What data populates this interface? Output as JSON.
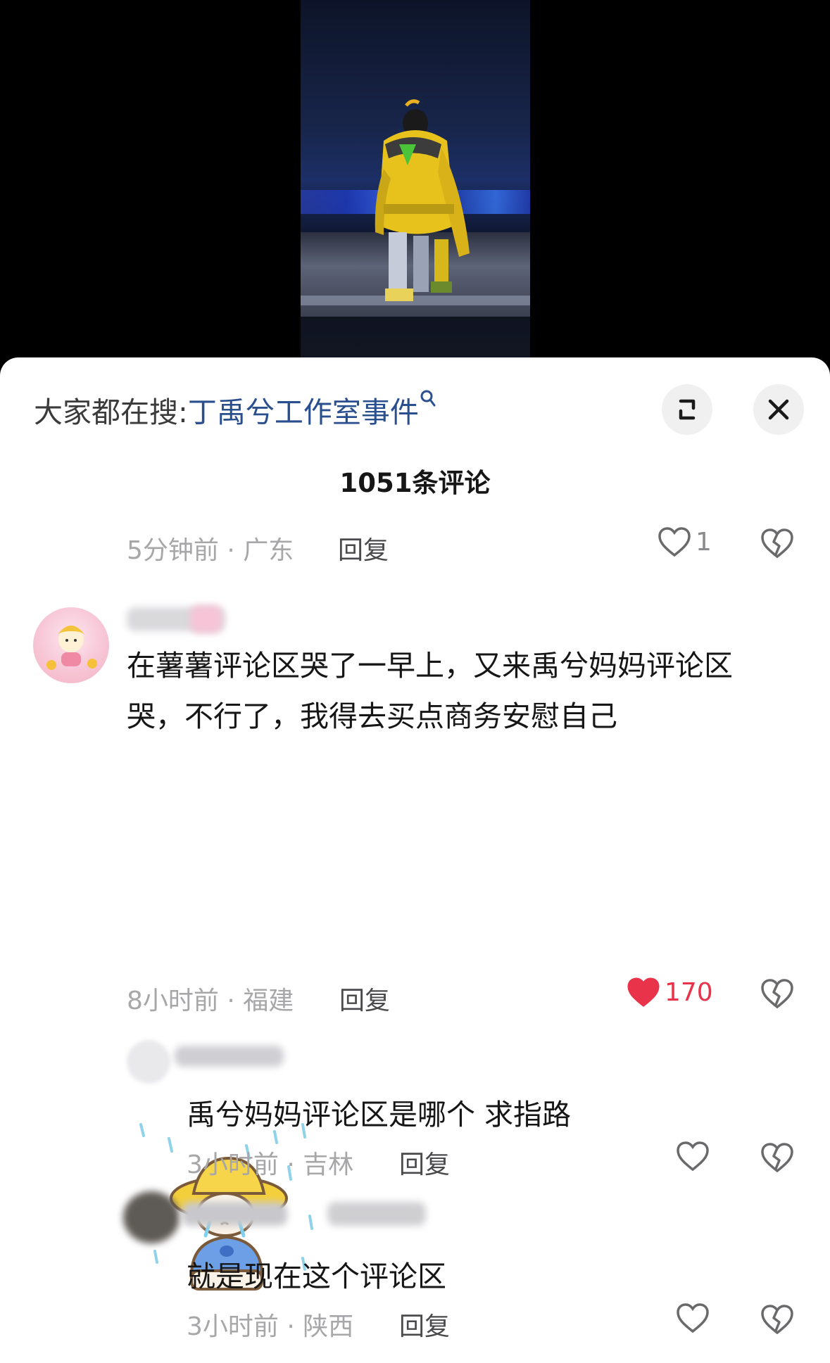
{
  "header": {
    "search_prefix": "大家都在搜:",
    "search_term": "丁禹兮工作室事件",
    "search_icon": "search-icon",
    "expand_icon": "expand-icon",
    "close_icon": "close-icon"
  },
  "comment_count": "1051条评论",
  "comments": [
    {
      "meta": "5分钟前 · 广东",
      "reply": "回复",
      "likes": "1",
      "liked": false
    },
    {
      "text_line1": "在薯薯评论区哭了一早上，又来禹兮妈妈评论区",
      "text_line2": "哭，不行了，我得去买点商务安慰自己",
      "has_sticker": true,
      "sticker_icon": "crying-bear-sticker",
      "meta": "8小时前 · 福建",
      "reply": "回复",
      "likes": "170",
      "liked": true,
      "like_color": "#e8334a"
    },
    {
      "text": "禹兮妈妈评论区是哪个 求指路",
      "meta": "3小时前 · 吉林",
      "reply": "回复",
      "likes": "",
      "liked": false
    },
    {
      "text": "就是现在这个评论区",
      "meta": "3小时前 · 陕西",
      "reply": "回复",
      "likes": "",
      "liked": false
    }
  ],
  "icons": {
    "like": "heart-icon",
    "dislike": "broken-heart-icon"
  }
}
